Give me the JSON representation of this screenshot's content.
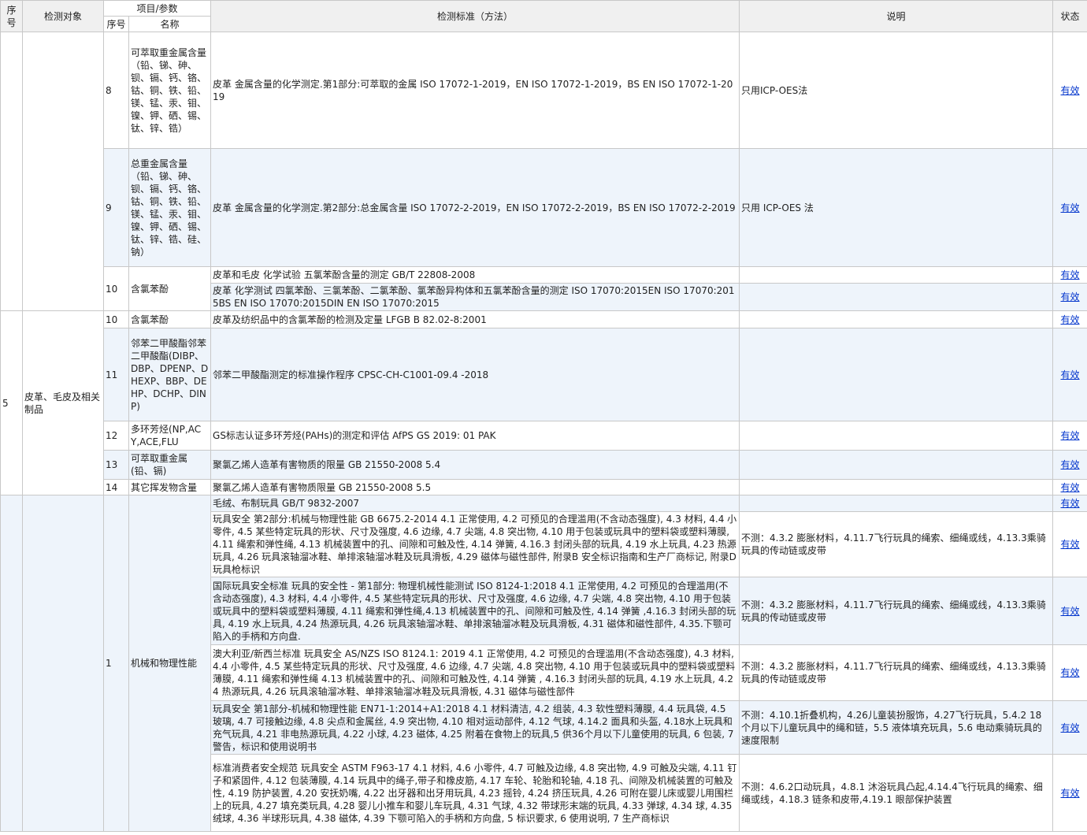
{
  "header": {
    "seq": "序号",
    "object": "检测对象",
    "item_param": "项目/参数",
    "sub_seq": "序号",
    "sub_name": "名称",
    "standard": "检测标准（方法）",
    "note": "说明",
    "status": "状态"
  },
  "groups": [
    {
      "seq": "",
      "object": "",
      "alt": false,
      "rows": [
        {
          "sub_seq": "8",
          "name": "可萃取重金属含量（铅、锑、砷、钡、镉、钙、铬、钴、铜、铁、铅、镁、锰、汞、钼、镍、钾、硒、锡、钛、锌、锆）",
          "standard": "皮革 金属含量的化学测定.第1部分:可萃取的金属 ISO 17072-1-2019，EN ISO 17072-1-2019，BS EN ISO 17072-1-2019",
          "note": "只用ICP-OES法",
          "status": "有效",
          "alt": false
        },
        {
          "sub_seq": "9",
          "name": "总重金属含量（铅、锑、砷、钡、镉、钙、铬、钴、铜、铁、铅、镁、锰、汞、钼、镍、钾、硒、锡、钛、锌、锆、硅、钠）",
          "standard": "皮革 金属含量的化学测定.第2部分:总金属含量 ISO 17072-2-2019，EN ISO 17072-2-2019，BS EN ISO 17072-2-2019",
          "note": "只用 ICP-OES 法",
          "status": "有效",
          "alt": true
        },
        {
          "sub_seq": "10",
          "name": "含氯苯酚",
          "rowspan": 2,
          "standard": "皮革和毛皮 化学试验 五氯苯酚含量的测定 GB/T 22808-2008",
          "note": "",
          "status": "有效",
          "alt": false
        },
        {
          "skip_left": true,
          "standard": "皮革 化学测试 四氯苯酚、三氯苯酚、二氯苯酚、氯苯酚异构体和五氯苯酚含量的测定 ISO 17070:2015EN ISO 17070:2015BS EN ISO 17070:2015DIN EN ISO 17070:2015",
          "note": "",
          "status": "有效",
          "alt": true
        }
      ]
    },
    {
      "seq": "5",
      "object": "皮革、毛皮及相关制品",
      "alt": false,
      "rows": [
        {
          "sub_seq": "10",
          "name": "含氯苯酚",
          "standard": "皮革及纺织品中的含氯苯酚的检测及定量 LFGB B 82.02-8:2001",
          "note": "",
          "status": "有效",
          "alt": false
        },
        {
          "sub_seq": "11",
          "name": "邻苯二甲酸酯邻苯二甲酸酯(DIBP、DBP、DPENP、DHEXP、BBP、DEHP、DCHP、DINP)",
          "standard": "邻苯二甲酸酯测定的标准操作程序 CPSC-CH-C1001-09.4 -2018",
          "note": "",
          "status": "有效",
          "alt": true
        },
        {
          "sub_seq": "12",
          "name": "多环芳烃(NP,ACY,ACE,FLU",
          "standard": "GS标志认证多环芳烃(PAHs)的测定和评估 AfPS GS 2019: 01 PAK",
          "note": "",
          "status": "有效",
          "alt": false
        },
        {
          "sub_seq": "13",
          "name": "可萃取重金属(铅、镉)",
          "standard": "聚氯乙烯人造革有害物质的限量 GB 21550-2008 5.4",
          "note": "",
          "status": "有效",
          "alt": true
        },
        {
          "sub_seq": "14",
          "name": "其它挥发物含量",
          "standard": "聚氯乙烯人造革有害物质限量 GB 21550-2008 5.5",
          "note": "",
          "status": "有效",
          "alt": false
        }
      ]
    },
    {
      "seq": "",
      "object": "",
      "alt": true,
      "rows": [
        {
          "sub_seq": "1",
          "name": "机械和物理性能",
          "rowspan": 6,
          "standard": "毛绒、布制玩具 GB/T 9832-2007",
          "note": "",
          "status": "有效",
          "alt": true
        },
        {
          "skip_left": true,
          "standard": "玩具安全 第2部分:机械与物理性能 GB 6675.2-2014 4.1 正常使用, 4.2 可预见的合理滥用(不含动态强度), 4.3 材料, 4.4 小零件, 4.5 某些特定玩具的形状、尺寸及强度, 4.6 边缘, 4.7 尖端, 4.8 突出物, 4.10 用于包装或玩具中的塑料袋或塑料薄膜, 4.11 绳索和弹性绳, 4.13 机械装置中的孔、间隙和可触及性, 4.14 弹簧, 4.16.3 封闭头部的玩具, 4.19 水上玩具, 4.23 热源玩具, 4.26 玩具滚轴溜冰鞋、单排滚轴溜冰鞋及玩具滑板, 4.29 磁体与磁性部件, 附录B 安全标识指南和生产厂商标记, 附录D 玩具枪标识",
          "note": "不测：4.3.2 膨胀材料，4.11.7飞行玩具的绳索、细绳或线，4.13.3乘骑玩具的传动链或皮带",
          "status": "有效",
          "alt": false
        },
        {
          "skip_left": true,
          "standard": "国际玩具安全标准 玩具的安全性 - 第1部分: 物理机械性能测试 ISO 8124-1:2018 4.1 正常使用, 4.2 可预见的合理滥用(不含动态强度), 4.3 材料, 4.4 小零件, 4.5 某些特定玩具的形状、尺寸及强度, 4.6 边缘, 4.7 尖端, 4.8 突出物, 4.10 用于包装或玩具中的塑料袋或塑料薄膜, 4.11 绳索和弹性绳,4.13 机械装置中的孔、间隙和可触及性, 4.14 弹簧 ,4.16.3 封闭头部的玩具, 4.19 水上玩具, 4.24 热源玩具, 4.26 玩具滚轴溜冰鞋、单排滚轴溜冰鞋及玩具滑板, 4.31 磁体和磁性部件, 4.35.下颚可陷入的手柄和方向盘.",
          "note": "不测：4.3.2 膨胀材料，4.11.7飞行玩具的绳索、细绳或线，4.13.3乘骑玩具的传动链或皮带",
          "status": "有效",
          "alt": true
        },
        {
          "skip_left": true,
          "standard": "澳大利亚/新西兰标准 玩具安全 AS/NZS ISO 8124.1: 2019 4.1 正常使用, 4.2 可预见的合理滥用(不含动态强度), 4.3 材料, 4.4 小零件, 4.5 某些特定玩具的形状、尺寸及强度, 4.6 边缘, 4.7 尖端, 4.8 突出物, 4.10 用于包装或玩具中的塑料袋或塑料薄膜, 4.11 绳索和弹性绳 4.13 机械装置中的孔、间隙和可触及性, 4.14 弹簧 , 4.16.3 封闭头部的玩具, 4.19 水上玩具, 4.24 热源玩具, 4.26 玩具滚轴溜冰鞋、单排滚轴溜冰鞋及玩具滑板, 4.31 磁体与磁性部件",
          "note": "不测：4.3.2 膨胀材料，4.11.7飞行玩具的绳索、细绳或线，4.13.3乘骑玩具的传动链或皮带",
          "status": "有效",
          "alt": false
        },
        {
          "skip_left": true,
          "standard": "玩具安全 第1部分-机械和物理性能 EN71-1:2014+A1:2018 4.1 材料清洁, 4.2 组装, 4.3 软性塑料薄膜, 4.4 玩具袋, 4.5 玻璃, 4.7 可接触边缘, 4.8 尖点和金属丝, 4.9 突出物, 4.10 相对运动部件, 4.12 气球, 4.14.2 面具和头盔, 4.18水上玩具和充气玩具, 4.21 非电热源玩具, 4.22 小球, 4.23 磁体, 4.25 附着在食物上的玩具,5 供36个月以下儿童使用的玩具, 6 包装, 7 警告，标识和使用说明书",
          "note": "不测：4.10.1折叠机构，4.26儿童装扮服饰，4.27飞行玩具，5.4.2 18个月以下儿童玩具中的绳和链，5.5 液体填充玩具，5.6 电动乘骑玩具的速度限制",
          "status": "有效",
          "alt": true
        },
        {
          "skip_left": true,
          "standard": "标准消费者安全规范 玩具安全 ASTM F963-17 4.1 材料, 4.6 小零件, 4.7 可触及边缘, 4.8 突出物, 4.9 可触及尖端, 4.11 钉子和紧固件, 4.12 包装薄膜, 4.14 玩具中的绳子,带子和橡皮筋, 4.17 车轮、轮胎和轮轴, 4.18 孔、间隙及机械装置的可触及性, 4.19 防护装置, 4.20 安抚奶嘴, 4.22 出牙器和出牙用玩具, 4.23 摇铃, 4.24 挤压玩具, 4.26 可附在婴儿床或婴儿用围栏上的玩具, 4.27 填充类玩具, 4.28 婴儿小推车和婴儿车玩具, 4.31 气球, 4.32 带球形末端的玩具, 4.33 弹球, 4.34 球, 4.35 绒球, 4.36 半球形玩具, 4.38 磁体, 4.39 下颚可陷入的手柄和方向盘, 5 标识要求, 6 使用说明, 7 生产商标识",
          "note": "不测：4.6.2口动玩具，4.8.1 沐浴玩具凸起,4.14.4飞行玩具的绳索、细绳或线，4.18.3 链条和皮带,4.19.1 眼部保护装置",
          "status": "有效",
          "alt": false
        }
      ]
    }
  ]
}
